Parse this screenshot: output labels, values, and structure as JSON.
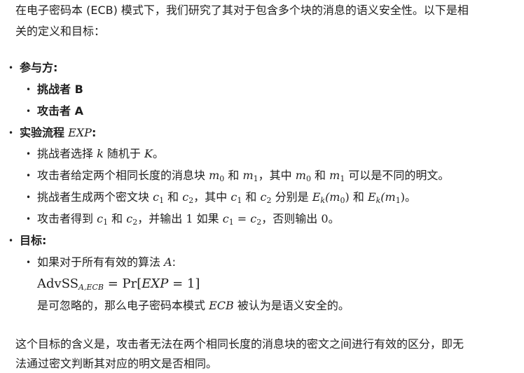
{
  "intro": {
    "line1": "在电子密码本 (ECB) 模式下，我们研究了其对于包含多个块的消息的语义安全性。以下是相",
    "line2": "关的定义和目标："
  },
  "participants": {
    "label": "参与方",
    "colon": ":",
    "items": [
      "挑战者 B",
      "攻击者 A"
    ]
  },
  "experiment": {
    "label": "实验流程",
    "symbol": "EXP",
    "colon": ":",
    "step1": {
      "t1": "挑战者选择",
      "k": "k",
      "t2": "随机于",
      "K": "K",
      "t3": "。"
    },
    "step2": {
      "t1": "攻击者给定两个相同长度的消息块",
      "t2": "和",
      "t3": "，其中",
      "t4": "和",
      "t5": "可以是不同的明文。",
      "m": "m",
      "s0": "0",
      "s1": "1"
    },
    "step3": {
      "t1": "挑战者生成两个密文块",
      "t2": "和",
      "t3": "，其中",
      "t4": "和",
      "t5": "分别是",
      "t6": "和",
      "t7": "。",
      "c": "c",
      "s1": "1",
      "s2": "2",
      "E": "E",
      "k": "k",
      "m0": "(m",
      "m0s": "0",
      "close": ")",
      "m1": "(m",
      "m1s": "1"
    },
    "step4": {
      "t1": "攻击者得到",
      "t2": "和",
      "t3": "，并输出",
      "one": "1",
      "t4": "如果",
      "eq": " = ",
      "t5": "，否则输出",
      "zero": "0",
      "t6": "。",
      "c": "c",
      "s1": "1",
      "s2": "2"
    }
  },
  "goal": {
    "label": "目标",
    "colon": ":",
    "cond": "如果对于所有有效的算法",
    "alg": "A",
    "cond_colon": ":",
    "formula": {
      "adv": "AdvSS",
      "sub": "A,ECB",
      "eq": " = Pr[",
      "exp": "EXP",
      "rest": " = 1]"
    },
    "conclusion": {
      "t1": "是可忽略的，那么电子密码本模式",
      "ecb": "ECB",
      "t2": "被认为是语义安全的。"
    }
  },
  "summary": {
    "line1": "这个目标的含义是，攻击者无法在两个相同长度的消息块的密文之间进行有效的区分，即无",
    "line2": "法通过密文判断其对应的明文是否相同。"
  }
}
